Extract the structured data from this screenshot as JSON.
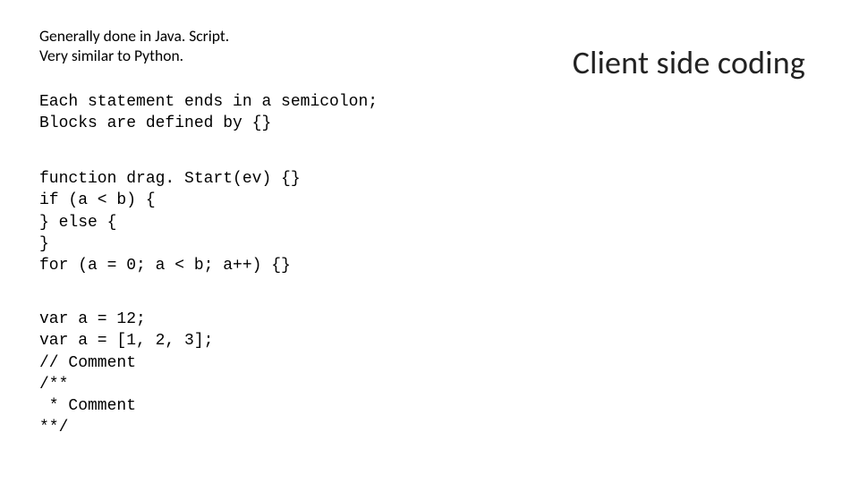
{
  "intro": {
    "line1": "Generally done in Java. Script.",
    "line2": "Very similar to Python."
  },
  "title": "Client side coding",
  "code": {
    "syntax_desc": "Each statement ends in a semicolon;\nBlocks are defined by {}",
    "structures": "function drag. Start(ev) {}\nif (a < b) {\n} else {\n}\nfor (a = 0; a < b; a++) {}",
    "vars_comments": "var a = 12;\nvar a = [1, 2, 3];\n// Comment\n/**\n * Comment\n**/"
  }
}
